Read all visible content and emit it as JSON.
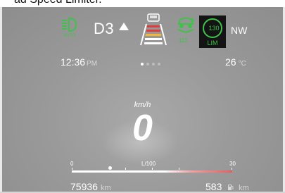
{
  "caption": {
    "text": "ad Speed Limiter."
  },
  "indicators": {
    "auto_light_label": "AUTO",
    "gear": "D3",
    "distance_value": "112",
    "limiter_speed": "130",
    "limiter_label": "LIM",
    "compass": "NW",
    "colors": {
      "active_green": "#3fc24a",
      "lane_red": "#e03a3a",
      "lane_yellow": "#f5b731"
    }
  },
  "info": {
    "time": "12:36",
    "time_period": "PM",
    "temperature": "26",
    "temperature_unit": "°C",
    "page_dots": 4,
    "active_page": 1
  },
  "speed": {
    "unit": "km/h",
    "value": "0"
  },
  "consumption": {
    "min_label": "0",
    "unit_label": "L/100",
    "max_label": "30"
  },
  "trip": {
    "odometer": "75936",
    "odometer_unit": "km",
    "range": "583",
    "range_unit": "km"
  }
}
